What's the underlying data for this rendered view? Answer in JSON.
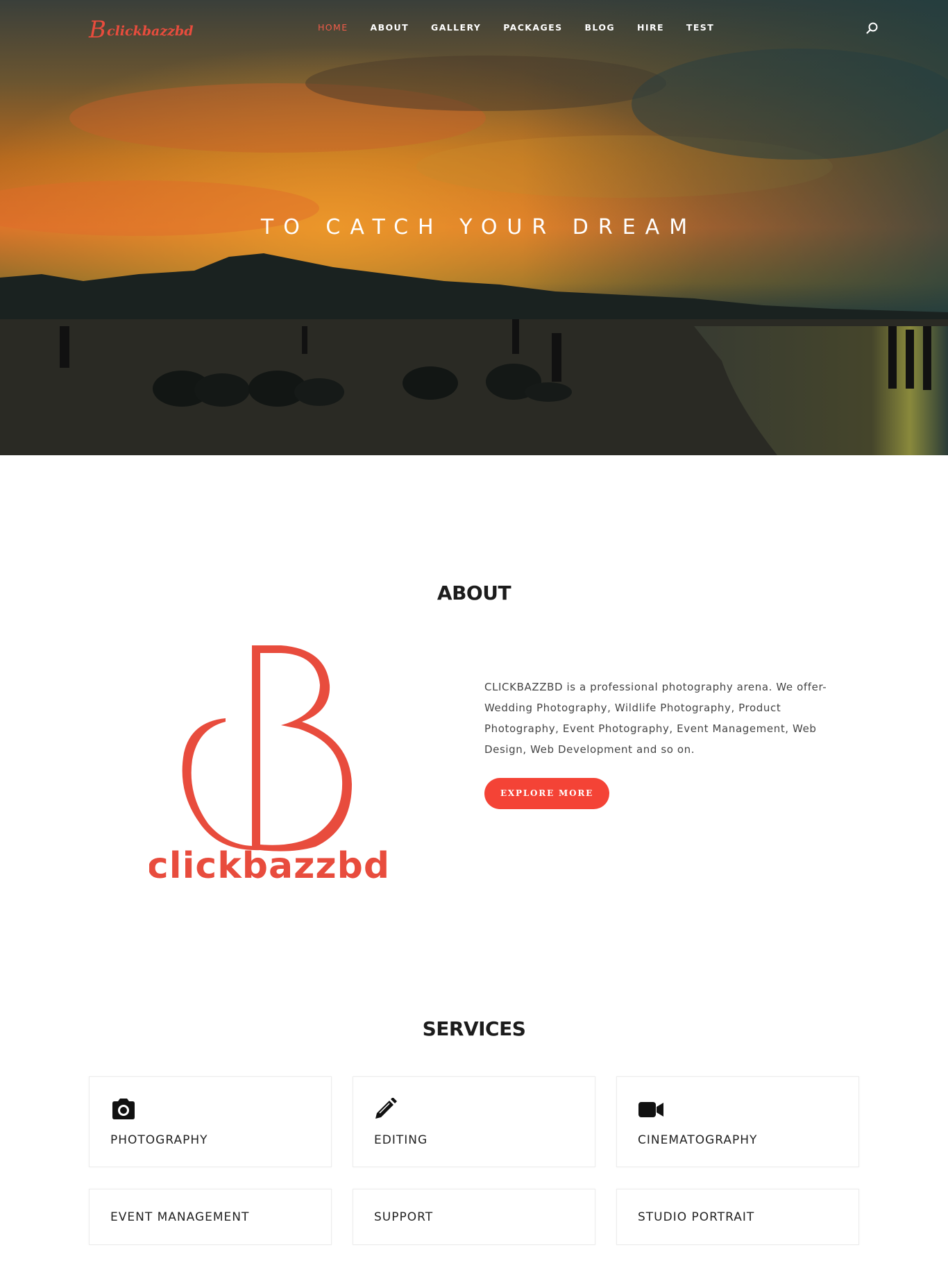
{
  "brand": {
    "mark": "B",
    "name": "clickbazzbd"
  },
  "nav": {
    "items": [
      {
        "label": "HOME",
        "active": true
      },
      {
        "label": "ABOUT"
      },
      {
        "label": "GALLERY"
      },
      {
        "label": "PACKAGES"
      },
      {
        "label": "BLOG"
      },
      {
        "label": "HIRE"
      },
      {
        "label": "TEST"
      }
    ],
    "search_icon": "search-icon"
  },
  "hero": {
    "title": "TO CATCH YOUR DREAM"
  },
  "about": {
    "title": "ABOUT",
    "logo_text": "clickbazzbd",
    "description": "CLICKBAZZBD is a professional photography arena. We offer- Wedding Photography, Wildlife Photography, Product Photography, Event Photography, Event Management, Web Design, Web Development and so on.",
    "button_label": "EXPLORE MORE"
  },
  "services": {
    "title": "SERVICES",
    "items": [
      {
        "label": "PHOTOGRAPHY",
        "icon": "camera-icon"
      },
      {
        "label": "EDITING",
        "icon": "pencil-icon"
      },
      {
        "label": "CINEMATOGRAPHY",
        "icon": "video-camera-icon"
      },
      {
        "label": "EVENT MANAGEMENT"
      },
      {
        "label": "SUPPORT"
      },
      {
        "label": "STUDIO PORTRAIT"
      }
    ]
  },
  "colors": {
    "accent": "#f44336",
    "brand": "#e84c3d",
    "text": "#222222"
  }
}
